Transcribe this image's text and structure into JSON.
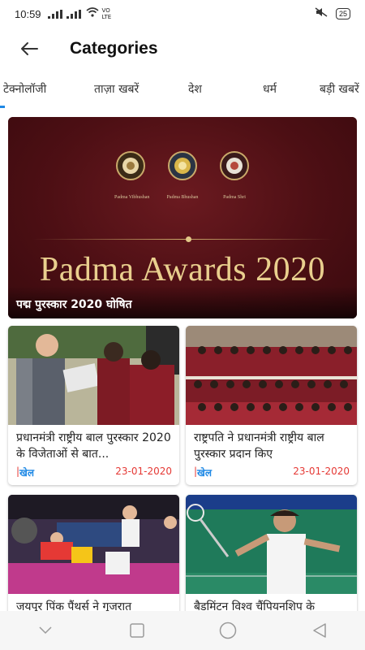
{
  "status_bar": {
    "time": "10:59",
    "network_label": "VO LTE",
    "battery": "25"
  },
  "header": {
    "title": "Categories"
  },
  "tabs": [
    {
      "label": "टेक्नोलॉजी"
    },
    {
      "label": "ताज़ा खबरें"
    },
    {
      "label": "देश"
    },
    {
      "label": "धर्म"
    },
    {
      "label": "बड़ी खबरें"
    }
  ],
  "featured": {
    "caption": "पद्म पुरस्कार 2020 घोषित",
    "image_text": "Padma Awards 2020",
    "medal_labels": [
      "Padma Vibhushan",
      "Padma Bhushan",
      "Padma Shri"
    ]
  },
  "cards": [
    {
      "title": "प्रधानमंत्री राष्ट्रीय बाल पुरस्कार 2020 के विजेताओं से बात...",
      "category": "खेल",
      "date": "23-01-2020"
    },
    {
      "title": "राष्ट्रपति ने प्रधानमंत्री राष्ट्रीय बाल पुरस्कार प्रदान किए",
      "category": "खेल",
      "date": "23-01-2020"
    },
    {
      "title": "जयपुर पिंक पैंथर्स ने गुजरात",
      "category": "",
      "date": ""
    },
    {
      "title": "बैडमिंटन विश्व चैंपियनशिप के",
      "category": "",
      "date": ""
    }
  ],
  "colors": {
    "accent": "#1e88e5",
    "date": "#e53935",
    "featured_bg": "#4d0f14"
  }
}
